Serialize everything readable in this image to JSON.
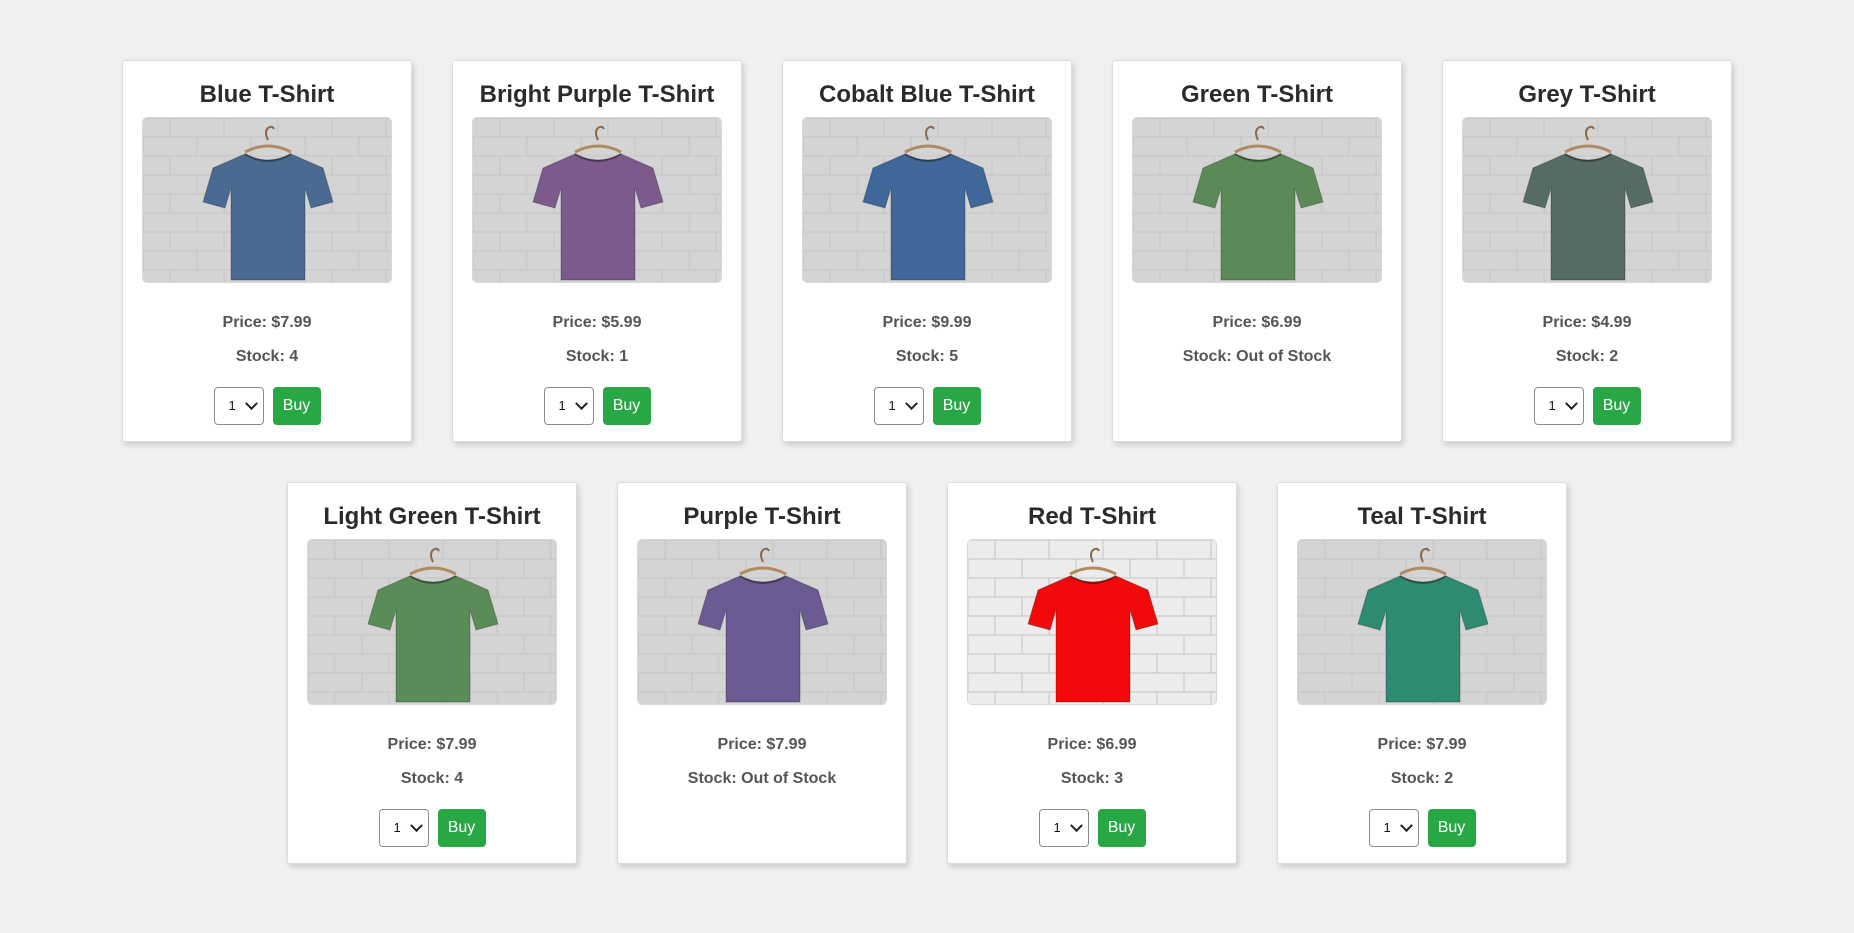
{
  "colors": {
    "background": "#f0f0f0",
    "card": "#ffffff",
    "buy_button": "#28a745"
  },
  "products": [
    {
      "name": "Blue T-Shirt",
      "price": "Price: $7.99",
      "stock": "Stock: 4",
      "qty": "1",
      "buy": "Buy",
      "in_stock": true,
      "shirt_color": "#4a6a92",
      "wall": "#d4d4d4"
    },
    {
      "name": "Bright Purple T-Shirt",
      "price": "Price: $5.99",
      "stock": "Stock: 1",
      "qty": "1",
      "buy": "Buy",
      "in_stock": true,
      "shirt_color": "#7c5a8c",
      "wall": "#d4d4d4"
    },
    {
      "name": "Cobalt Blue T-Shirt",
      "price": "Price: $9.99",
      "stock": "Stock: 5",
      "qty": "1",
      "buy": "Buy",
      "in_stock": true,
      "shirt_color": "#3f679a",
      "wall": "#d4d4d4"
    },
    {
      "name": "Green T-Shirt",
      "price": "Price: $6.99",
      "stock": "Stock: Out of Stock",
      "qty": "",
      "buy": "",
      "in_stock": false,
      "shirt_color": "#5b8a57",
      "wall": "#d4d4d4"
    },
    {
      "name": "Grey T-Shirt",
      "price": "Price: $4.99",
      "stock": "Stock: 2",
      "qty": "1",
      "buy": "Buy",
      "in_stock": true,
      "shirt_color": "#566c63",
      "wall": "#d4d4d4"
    },
    {
      "name": "Light Green T-Shirt",
      "price": "Price: $7.99",
      "stock": "Stock: 4",
      "qty": "1",
      "buy": "Buy",
      "in_stock": true,
      "shirt_color": "#5a8c58",
      "wall": "#d4d4d4"
    },
    {
      "name": "Purple T-Shirt",
      "price": "Price: $7.99",
      "stock": "Stock: Out of Stock",
      "qty": "",
      "buy": "",
      "in_stock": false,
      "shirt_color": "#6c5a92",
      "wall": "#d4d4d4"
    },
    {
      "name": "Red T-Shirt",
      "price": "Price: $6.99",
      "stock": "Stock: 3",
      "qty": "1",
      "buy": "Buy",
      "in_stock": true,
      "shirt_color": "#f20a0a",
      "wall": "#ececec"
    },
    {
      "name": "Teal T-Shirt",
      "price": "Price: $7.99",
      "stock": "Stock: 2",
      "qty": "1",
      "buy": "Buy",
      "in_stock": true,
      "shirt_color": "#2f8a72",
      "wall": "#d4d4d4"
    }
  ]
}
